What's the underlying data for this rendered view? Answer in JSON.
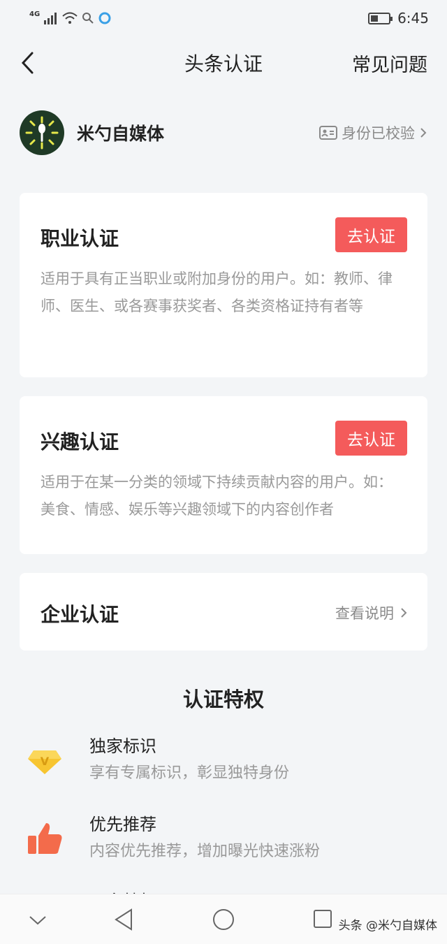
{
  "status_bar": {
    "network": "4G",
    "time": "6:45"
  },
  "nav": {
    "title": "头条认证",
    "faq_label": "常见问题"
  },
  "profile": {
    "name": "米勺自媒体",
    "verified_label": "身份已校验"
  },
  "cards": [
    {
      "title": "职业认证",
      "button": "去认证",
      "description": "适用于具有正当职业或附加身份的用户。如：教师、律师、医生、或各赛事获奖者、各类资格证持有者等"
    },
    {
      "title": "兴趣认证",
      "button": "去认证",
      "description": "适用于在某一分类的领域下持续贡献内容的用户。如：美食、情感、娱乐等兴趣领域下的内容创作者"
    },
    {
      "title": "企业认证",
      "link": "查看说明"
    }
  ],
  "privileges": {
    "title": "认证特权",
    "items": [
      {
        "title": "独家标识",
        "desc": "享有专属标识，彰显独特身份",
        "icon": "diamond-v-icon"
      },
      {
        "title": "优先推荐",
        "desc": "内容优先推荐，增加曝光快速涨粉",
        "icon": "thumbs-up-icon"
      },
      {
        "title": "更多特权",
        "desc": "",
        "icon": ""
      }
    ]
  },
  "watermark": "头条 @米勺自媒体",
  "colors": {
    "accent": "#f45b5b",
    "background": "#f3f5f7",
    "avatar_bg": "#1f3a26"
  }
}
